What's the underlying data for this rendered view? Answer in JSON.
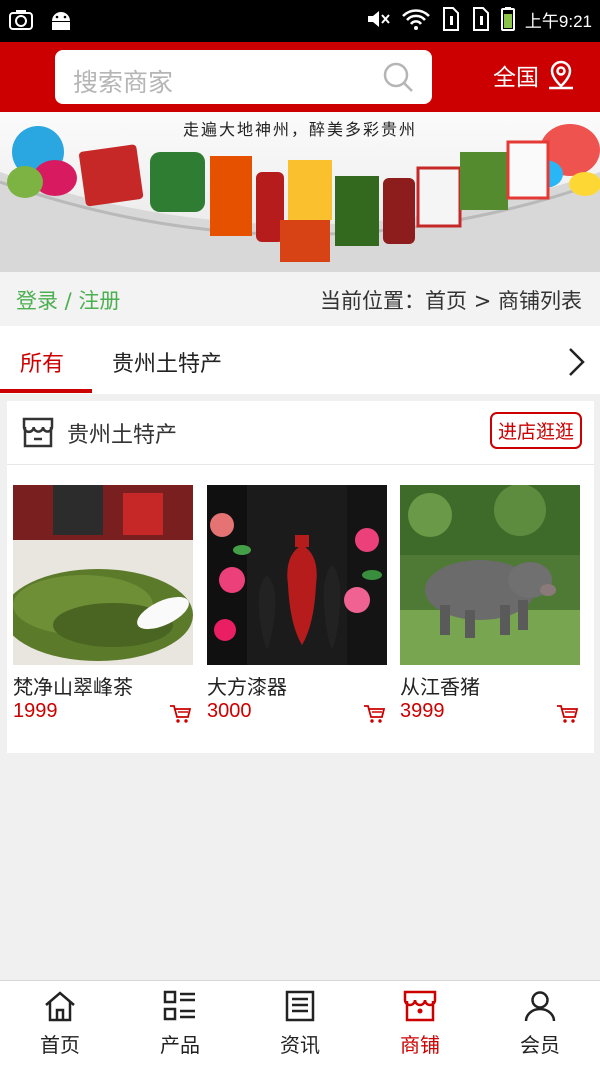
{
  "status_bar": {
    "time": "上午9:21"
  },
  "header": {
    "search_placeholder": "搜索商家",
    "region_label": "全国"
  },
  "banner": {
    "slogan": "走遍大地神州，醉美多彩贵州"
  },
  "crumb_row": {
    "login_label": "登录 / 注册",
    "breadcrumb": "当前位置：首页 > 商铺列表"
  },
  "tabs": [
    {
      "label": "所有",
      "active": true
    },
    {
      "label": "贵州土特产",
      "active": false
    }
  ],
  "shop": {
    "name": "贵州土特产",
    "visit_button": "进店逛逛",
    "products": [
      {
        "name": "梵净山翠峰茶",
        "price": "1999"
      },
      {
        "name": "大方漆器",
        "price": "3000"
      },
      {
        "name": "从江香猪",
        "price": "3999"
      }
    ]
  },
  "bottom_nav": [
    {
      "label": "首页",
      "icon": "home-icon"
    },
    {
      "label": "产品",
      "icon": "list-icon"
    },
    {
      "label": "资讯",
      "icon": "news-icon"
    },
    {
      "label": "商铺",
      "icon": "store-icon",
      "active": true
    },
    {
      "label": "会员",
      "icon": "user-icon"
    }
  ],
  "colors": {
    "brand": "#cc0000",
    "login": "#4caf50",
    "price": "#cc0000"
  }
}
